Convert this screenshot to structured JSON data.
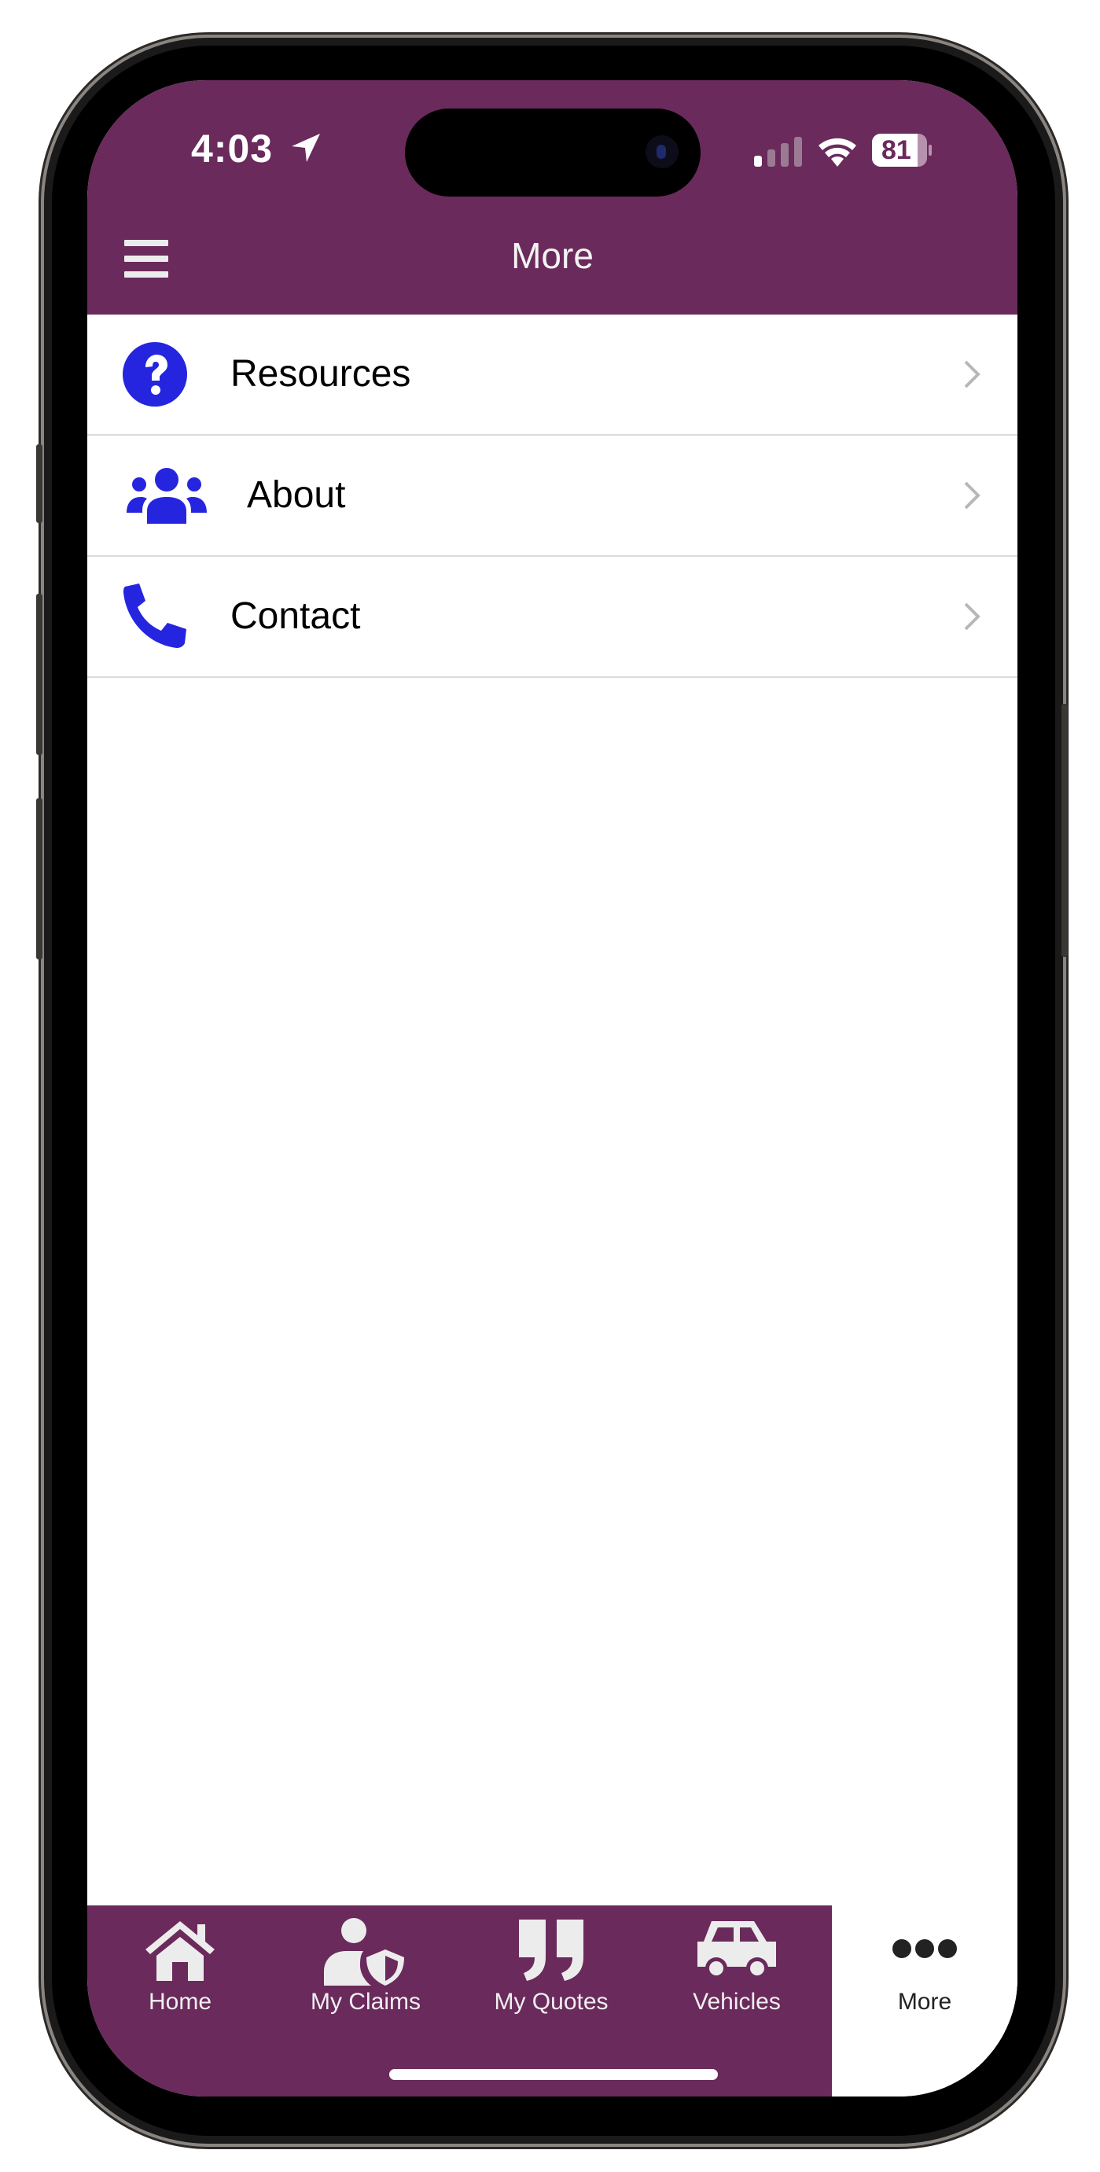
{
  "status_bar": {
    "time": "4:03",
    "battery": "81",
    "icons": [
      "location-arrow-icon",
      "cellular-signal-icon",
      "wifi-icon",
      "battery-icon"
    ]
  },
  "header": {
    "title": "More",
    "menu_icon": "hamburger-menu-icon"
  },
  "colors": {
    "brand": "#6a2a5b",
    "icon_accent": "#2525e0",
    "tab_text": "#f1eef1",
    "active_tab_bg": "#ffffff"
  },
  "menu": {
    "items": [
      {
        "label": "Resources",
        "icon": "question-circle-icon"
      },
      {
        "label": "About",
        "icon": "users-icon"
      },
      {
        "label": "Contact",
        "icon": "phone-icon"
      }
    ]
  },
  "tabbar": {
    "items": [
      {
        "label": "Home",
        "icon": "home-icon",
        "active": false
      },
      {
        "label": "My Claims",
        "icon": "user-shield-icon",
        "active": false
      },
      {
        "label": "My Quotes",
        "icon": "quote-icon",
        "active": false
      },
      {
        "label": "Vehicles",
        "icon": "car-icon",
        "active": false
      },
      {
        "label": "More",
        "icon": "ellipsis-icon",
        "active": true
      }
    ]
  }
}
